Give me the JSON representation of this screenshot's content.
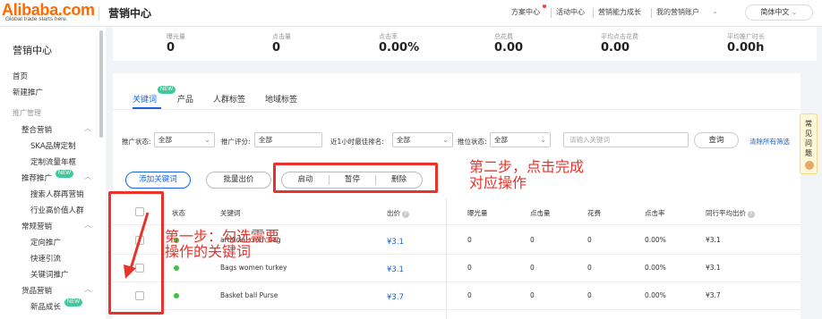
{
  "header": {
    "logo_text": "Alibaba.com",
    "logo_tagline": "Global trade starts here.",
    "app_title": "营销中心",
    "nav": [
      "方案中心",
      "活动中心",
      "营销能力成长",
      "我的营销账户"
    ],
    "language": "简体中文"
  },
  "sidebar": {
    "title": "营销中心",
    "top_items": [
      "首页",
      "新建推广"
    ],
    "group_label": "推广管理",
    "sections": [
      {
        "label": "整合营销",
        "children": [
          "SKA品牌定制",
          "定制流量年框"
        ]
      },
      {
        "label": "推荐推广",
        "badge": "NEW",
        "children": [
          "搜索人群再营销",
          "行业高价值人群"
        ]
      },
      {
        "label": "常规营销",
        "children": [
          "定向推广",
          "快速引流",
          "关键词推广"
        ]
      },
      {
        "label": "货品营销",
        "children": [
          "新品成长"
        ],
        "child_badge": "NEW"
      }
    ]
  },
  "stats": [
    {
      "label": "曝光量",
      "value": "0"
    },
    {
      "label": "点击量",
      "value": "0"
    },
    {
      "label": "点击率",
      "value": "0.00%"
    },
    {
      "label": "总花费",
      "value": "0.00"
    },
    {
      "label": "平均点击花费",
      "value": "0.00"
    },
    {
      "label": "平均推广时长",
      "value": "0.00h"
    }
  ],
  "tabs": {
    "items": [
      "关键词",
      "产品",
      "人群标签",
      "地域标签"
    ],
    "active": "关键词",
    "badge": "NEW"
  },
  "filters": {
    "status_label": "推广状态:",
    "status_value": "全部",
    "score_label": "推广评分:",
    "score_value": "全部",
    "rank_label": "近1小时最佳排名:",
    "rank_value": "全部",
    "slot_label": "推位状态:",
    "slot_value": "全部",
    "keyword_placeholder": "请输入关键词",
    "search_button": "查询",
    "clear_link": "清除所有筛选"
  },
  "actions": {
    "add_keyword": "添加关键词",
    "bulk_bid": "批量出价",
    "start": "启动",
    "pause": "暂停",
    "delete": "删除"
  },
  "table": {
    "columns": [
      "状态",
      "关键词",
      "出价",
      "曝光量",
      "点击量",
      "花费",
      "点击率",
      "同行平均出价"
    ],
    "rows": [
      {
        "keyword": "artificial cloth bag",
        "bid": "¥3.1",
        "impressions": "0",
        "clicks": "0",
        "cost": "0",
        "ctr": "0.00%",
        "peer_bid": "¥3.1"
      },
      {
        "keyword": "Bags women turkey",
        "bid": "¥3.1",
        "impressions": "0",
        "clicks": "0",
        "cost": "0",
        "ctr": "0.00%",
        "peer_bid": "¥3.1"
      },
      {
        "keyword": "Basket ball Purse",
        "bid": "¥3.7",
        "impressions": "0",
        "clicks": "0",
        "cost": "0",
        "ctr": "0.00%",
        "peer_bid": "¥3.7"
      }
    ]
  },
  "help_widget": {
    "text": [
      "常",
      "见",
      "问",
      "题"
    ]
  },
  "annotations": {
    "step1_line1": "第一步：勾选需要",
    "step1_line2": "操作的关键词",
    "step2_line1": "第二步，点击完成",
    "step2_line2": "对应操作"
  },
  "colors": {
    "brand": "#ff6a00",
    "primary": "#1764d8",
    "annotation": "#e8332a",
    "active_status": "#3fbf3f"
  },
  "icons": [
    "chevron-down-icon",
    "help-question-icon",
    "status-dot-icon",
    "arrow-annotation-icon"
  ]
}
